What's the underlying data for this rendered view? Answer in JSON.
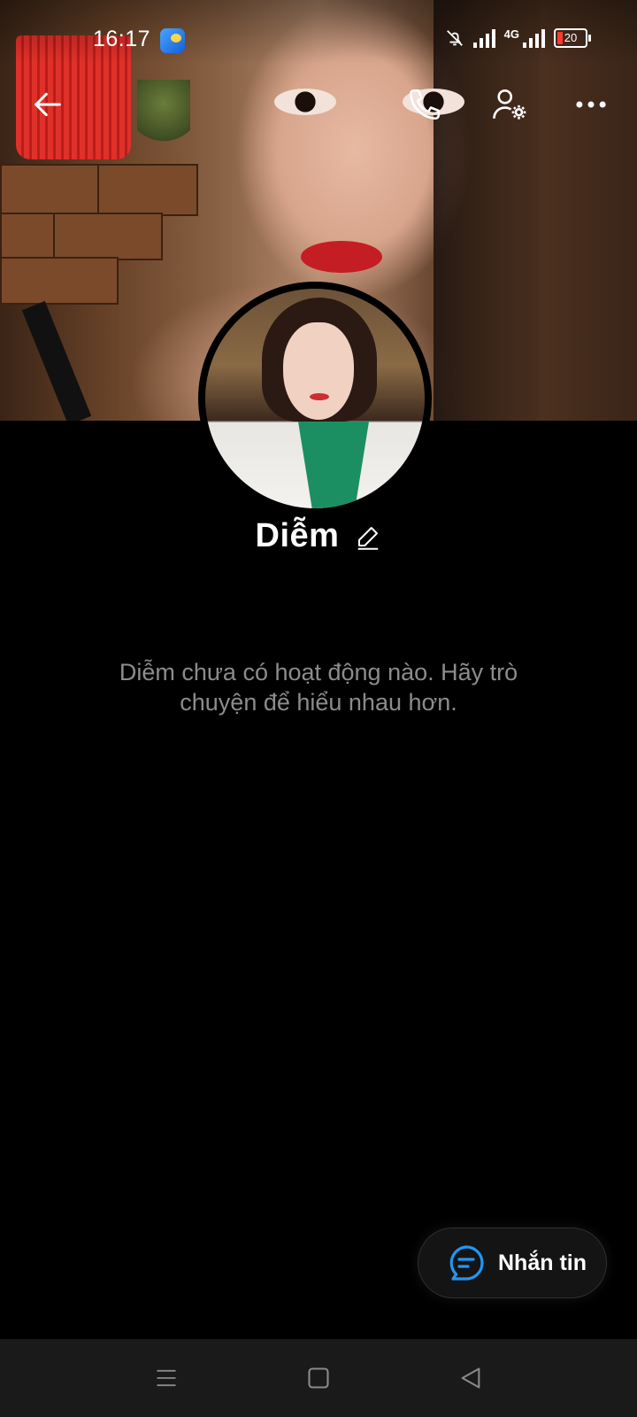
{
  "status_bar": {
    "time": "16:17",
    "network": "4G",
    "battery": "20"
  },
  "profile": {
    "name": "Diễm",
    "empty_message": "Diễm chưa có hoạt động nào. Hãy trò chuyện để hiểu nhau hơn."
  },
  "actions": {
    "message_label": "Nhắn tin"
  },
  "icons": {
    "back": "arrow-left-icon",
    "call": "phone-icon",
    "settings": "user-settings-icon",
    "more": "more-horizontal-icon",
    "edit": "pencil-icon",
    "message": "chat-bubble-icon"
  },
  "colors": {
    "background": "#000000",
    "accent": "#2196f3",
    "muted_text": "#8c8c8c",
    "navbar": "#1a1a1a"
  }
}
